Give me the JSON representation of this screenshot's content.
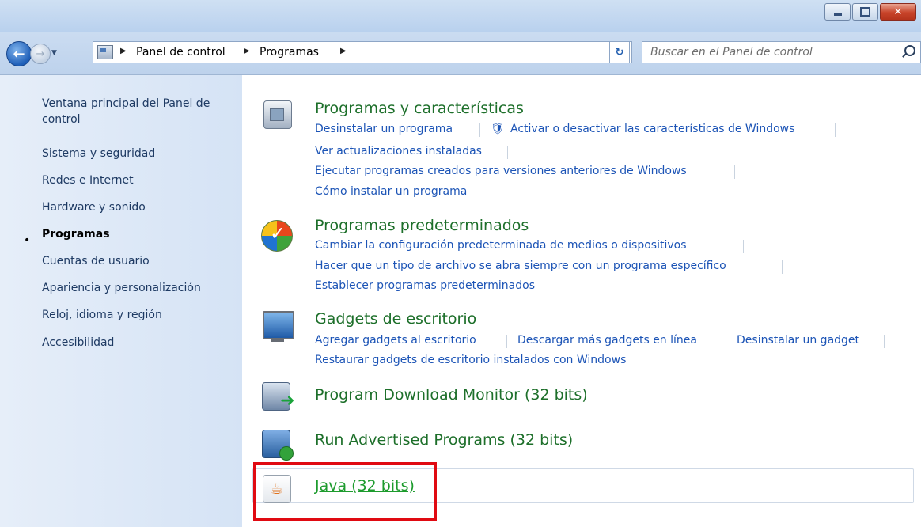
{
  "window": {
    "minimize_label": "minimize",
    "maximize_label": "maximize",
    "close_label": "x"
  },
  "address_bar": {
    "breadcrumbs": [
      "Panel de control",
      "Programas"
    ],
    "search_placeholder": "Buscar en el Panel de control"
  },
  "sidebar": {
    "items": [
      {
        "label": "Ventana principal del Panel de control",
        "current": false
      },
      {
        "label": "Sistema y seguridad",
        "current": false
      },
      {
        "label": "Redes e Internet",
        "current": false
      },
      {
        "label": "Hardware y sonido",
        "current": false
      },
      {
        "label": "Programas",
        "current": true
      },
      {
        "label": "Cuentas de usuario",
        "current": false
      },
      {
        "label": "Apariencia y personalización",
        "current": false
      },
      {
        "label": "Reloj, idioma y región",
        "current": false
      },
      {
        "label": "Accesibilidad",
        "current": false
      }
    ]
  },
  "categories": [
    {
      "title": "Programas y características",
      "icon": "programs-and-features-icon",
      "tasks": [
        "Desinstalar un programa",
        "Activar o desactivar las características de Windows",
        "Ver actualizaciones instaladas",
        "Ejecutar programas creados para versiones anteriores de Windows",
        "Cómo instalar un programa"
      ]
    },
    {
      "title": "Programas predeterminados",
      "icon": "default-programs-icon",
      "tasks": [
        "Cambiar la configuración predeterminada de medios o dispositivos",
        "Hacer que un tipo de archivo se abra siempre con un programa específico",
        "Establecer programas predeterminados"
      ]
    },
    {
      "title": "Gadgets de escritorio",
      "icon": "desktop-gadgets-icon",
      "tasks": [
        "Agregar gadgets al escritorio",
        "Descargar más gadgets en línea",
        "Desinstalar un gadget",
        "Restaurar gadgets de escritorio instalados con Windows"
      ]
    },
    {
      "title": "Program Download Monitor (32 bits)",
      "icon": "download-monitor-icon"
    },
    {
      "title": "Run Advertised Programs (32 bits)",
      "icon": "advertised-programs-icon"
    },
    {
      "title": "Java (32 bits)",
      "icon": "java-icon",
      "highlighted": true
    }
  ],
  "colors": {
    "link": "#1c54b6",
    "category_title": "#1d6f2a",
    "highlight": "#e00a12"
  }
}
